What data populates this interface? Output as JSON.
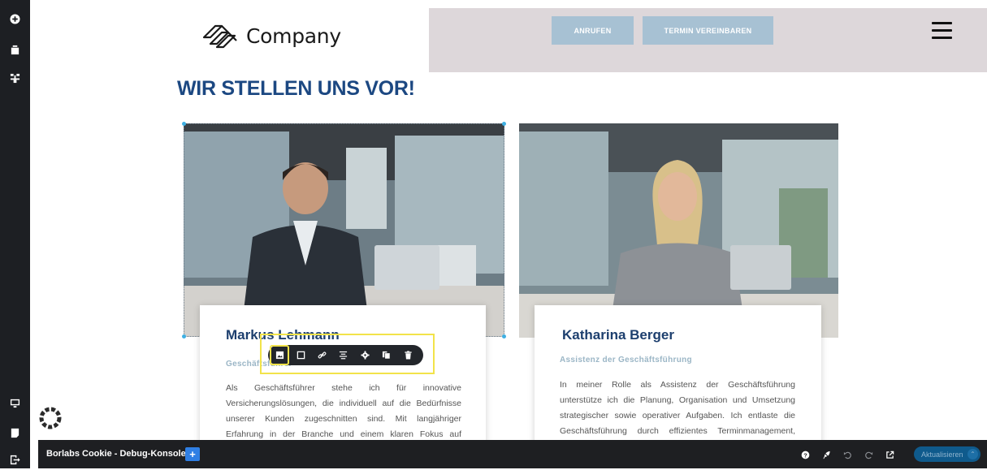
{
  "logo": {
    "text": "Company"
  },
  "header": {
    "call_label": "ANRUFEN",
    "appointment_label": "TERMIN VEREINBAREN"
  },
  "section": {
    "heading": "WIR STELLEN UNS VOR!"
  },
  "team": [
    {
      "name": "Markus Lehmann",
      "role": "Geschäftsführer",
      "bio": "Als Geschäftsführer stehe ich für innovative Versicherungslösungen, die individuell auf die Bedürfnisse unserer Kunden zugeschnitten sind. Mit langjähriger Erfahrung in der Branche und einem klaren Fokus auf"
    },
    {
      "name": "Katharina Berger",
      "role": "Assistenz der Geschäftsführung",
      "bio": "In meiner Rolle als Assistenz der Geschäftsführung unterstütze ich die Planung, Organisation und Umsetzung strategischer sowie operativer Aufgaben. Ich entlaste die Geschäftsführung durch effizientes Terminmanagement,"
    }
  ],
  "image_toolbar": {
    "buttons": [
      "image-icon",
      "frame-icon",
      "link-icon",
      "align-icon",
      "gear-icon",
      "copy-icon",
      "trash-icon"
    ],
    "active": "image-icon"
  },
  "sidebar": {
    "top_icons": [
      "add-icon",
      "page-icon",
      "layout-icon"
    ],
    "bottom_icons": [
      "desktop-icon",
      "template-icon",
      "exit-icon"
    ]
  },
  "cookie_console": {
    "title": "Borlabs Cookie - Debug-Konsole",
    "plus_label": "+",
    "icons": [
      "help-icon",
      "feather-icon",
      "undo-icon",
      "redo-icon",
      "external-link-icon"
    ],
    "update_label": "Aktualisieren",
    "update_caret": "⌃"
  },
  "colors": {
    "heading": "#1c4882",
    "header_band": "#ddd7da",
    "header_button": "#a7c1d3",
    "sidebar": "#1d1f23",
    "toolbar_highlight": "#f2e34a",
    "selection_handle": "#3fb0e3",
    "update_button": "#0f5a8c"
  }
}
